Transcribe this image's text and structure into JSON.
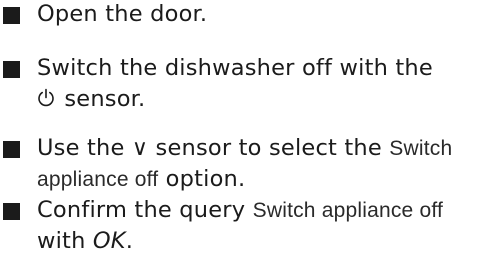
{
  "steps": [
    {
      "text": "Open the door."
    },
    {
      "line1": "Switch the dishwasher off with the",
      "power_symbol": "⏻",
      "line2_rest": " sensor."
    },
    {
      "line1_a": "Use the ",
      "down_symbol": "∨",
      "line1_b": " sensor to select the ",
      "line1_ui": "Switch",
      "line2_ui": "appliance off",
      "line2_rest": " option."
    },
    {
      "line1_a": "Confirm the query ",
      "line1_ui": "Switch appliance off",
      "line2_a": "with ",
      "line2_em": "OK",
      "line2_b": "."
    }
  ]
}
